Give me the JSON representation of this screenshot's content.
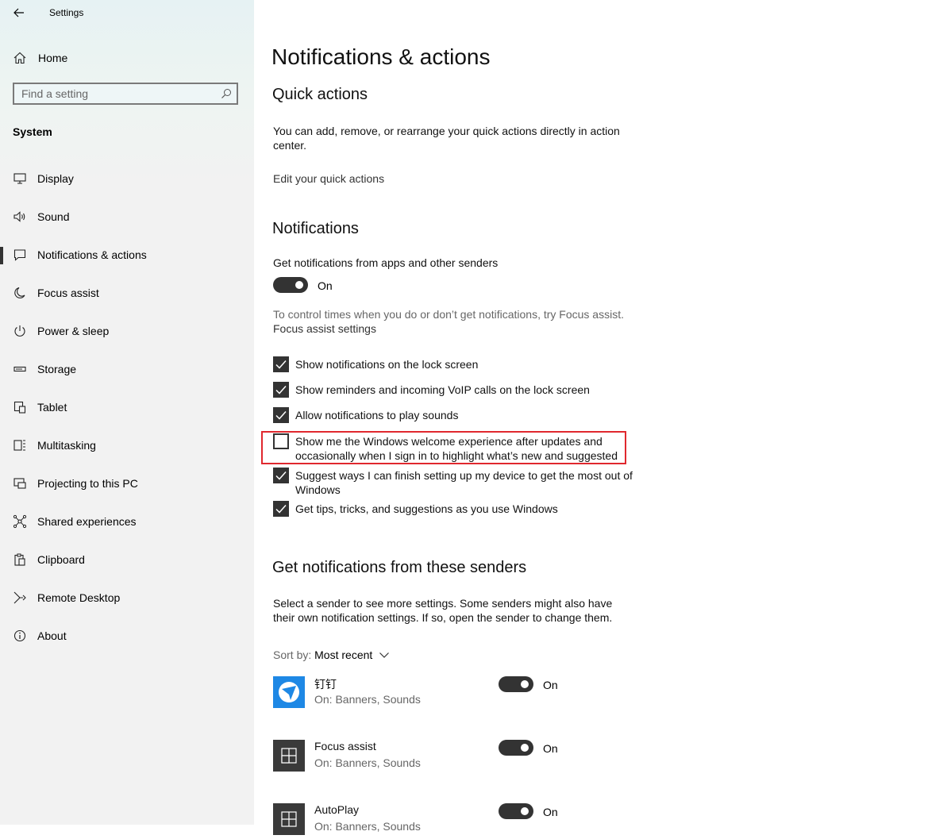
{
  "window": {
    "title": "Settings"
  },
  "sidebar": {
    "home_label": "Home",
    "search_placeholder": "Find a setting",
    "section_label": "System",
    "items": [
      {
        "label": "Display",
        "icon": "monitor-icon"
      },
      {
        "label": "Sound",
        "icon": "speaker-icon"
      },
      {
        "label": "Notifications & actions",
        "icon": "notification-icon",
        "active": true
      },
      {
        "label": "Focus assist",
        "icon": "moon-icon"
      },
      {
        "label": "Power & sleep",
        "icon": "power-icon"
      },
      {
        "label": "Storage",
        "icon": "storage-icon"
      },
      {
        "label": "Tablet",
        "icon": "tablet-icon"
      },
      {
        "label": "Multitasking",
        "icon": "multitasking-icon"
      },
      {
        "label": "Projecting to this PC",
        "icon": "projecting-icon"
      },
      {
        "label": "Shared experiences",
        "icon": "shared-icon"
      },
      {
        "label": "Clipboard",
        "icon": "clipboard-icon"
      },
      {
        "label": "Remote Desktop",
        "icon": "remote-desktop-icon"
      },
      {
        "label": "About",
        "icon": "info-icon"
      }
    ]
  },
  "main": {
    "title": "Notifications & actions",
    "quick_actions": {
      "heading": "Quick actions",
      "description": "You can add, remove, or rearrange your quick actions directly in action center.",
      "link": "Edit your quick actions"
    },
    "notifications": {
      "heading": "Notifications",
      "get_label": "Get notifications from apps and other senders",
      "toggle_state": "On",
      "focus_hint": "To control times when you do or don’t get notifications, try Focus assist.",
      "focus_link": "Focus assist settings",
      "checkboxes": [
        {
          "label": "Show notifications on the lock screen",
          "checked": true
        },
        {
          "label": "Show reminders and incoming VoIP calls on the lock screen",
          "checked": true
        },
        {
          "label": "Allow notifications to play sounds",
          "checked": true
        },
        {
          "label": "Show me the Windows welcome experience after updates and occasionally when I sign in to highlight what’s new and suggested",
          "checked": false
        },
        {
          "label": "Suggest ways I can finish setting up my device to get the most out of Windows",
          "checked": true
        },
        {
          "label": "Get tips, tricks, and suggestions as you use Windows",
          "checked": true
        }
      ]
    },
    "senders": {
      "heading": "Get notifications from these senders",
      "description": "Select a sender to see more settings. Some senders might also have their own notification settings. If so, open the sender to change them.",
      "sort_label": "Sort by:",
      "sort_value": "Most recent",
      "items": [
        {
          "name": "钉钉",
          "sub": "On: Banners, Sounds",
          "state": "On"
        },
        {
          "name": "Focus assist",
          "sub": "On: Banners, Sounds",
          "state": "On"
        },
        {
          "name": "AutoPlay",
          "sub": "On: Banners, Sounds",
          "state": "On"
        }
      ]
    }
  },
  "colors": {
    "accent_dark": "#333333",
    "highlight_border": "#e0282e",
    "dingtalk_blue": "#1e88e5"
  }
}
